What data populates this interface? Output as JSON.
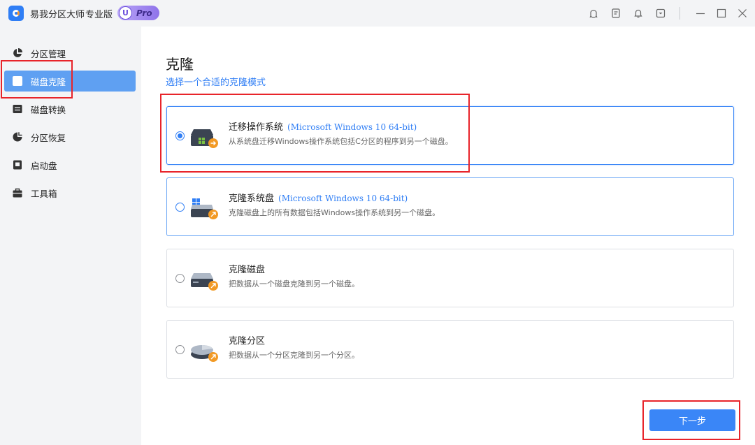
{
  "app": {
    "name": "易我分区大师",
    "edition": "专业版",
    "badge_letter": "U",
    "badge_text": "Pro"
  },
  "titlebar_icons": [
    "support-icon",
    "feedback-icon",
    "notification-icon",
    "dropdown-menu-icon"
  ],
  "window_controls": [
    "minimize-icon",
    "maximize-icon",
    "close-icon"
  ],
  "sidebar": {
    "items": [
      {
        "label": "分区管理",
        "icon": "pie-chart-icon",
        "active": false
      },
      {
        "label": "磁盘克隆",
        "icon": "disk-clone-icon",
        "active": true
      },
      {
        "label": "磁盘转换",
        "icon": "disk-convert-icon",
        "active": false
      },
      {
        "label": "分区恢复",
        "icon": "partition-recovery-icon",
        "active": false
      },
      {
        "label": "启动盘",
        "icon": "boot-disk-icon",
        "active": false
      },
      {
        "label": "工具箱",
        "icon": "toolbox-icon",
        "active": false
      }
    ]
  },
  "main": {
    "title": "克隆",
    "subtitle": "选择一个合适的克隆模式",
    "options": [
      {
        "title": "迁移操作系统",
        "os": "(Microsoft Windows 10 64-bit)",
        "desc": "从系统盘迁移Windows操作系统包括C分区的程序到另一个磁盘。",
        "selected": true
      },
      {
        "title": "克隆系统盘",
        "os": "(Microsoft Windows 10 64-bit)",
        "desc": "克隆磁盘上的所有数据包括Windows操作系统到另一个磁盘。",
        "selected": false
      },
      {
        "title": "克隆磁盘",
        "os": "",
        "desc": "把数据从一个磁盘克隆到另一个磁盘。",
        "selected": false
      },
      {
        "title": "克隆分区",
        "os": "",
        "desc": "把数据从一个分区克隆到另一个分区。",
        "selected": false
      }
    ],
    "next_label": "下一步"
  },
  "colors": {
    "accent": "#2f7ef5",
    "sidebar_active": "#5fa0f2",
    "highlight": "#e8242a"
  }
}
